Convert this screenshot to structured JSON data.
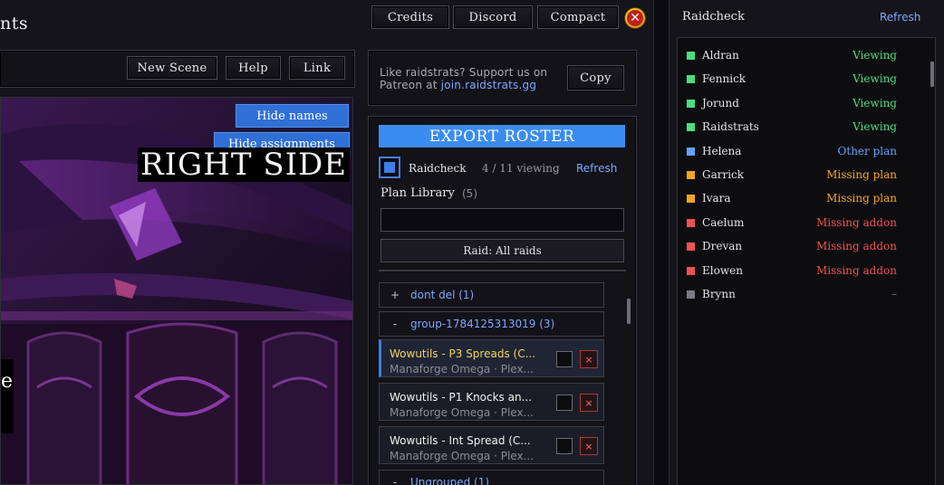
{
  "main": {
    "title_fragment": "nts",
    "top_buttons": {
      "credits": "Credits",
      "discord": "Discord",
      "compact": "Compact"
    },
    "toolbar": {
      "new_scene": "New Scene",
      "help": "Help",
      "link": "Link"
    },
    "scene": {
      "heading": "RIGHT SIDE",
      "hide_names": "Hide names",
      "hide_assignments": "Hide assignments",
      "label_fragment": "e"
    },
    "support": {
      "text": "Like raidstrats? Support us on Patreon at",
      "link": "join.raidstrats.gg",
      "copy": "Copy"
    },
    "export_roster": "EXPORT ROSTER",
    "raidcheck": {
      "label": "Raidcheck",
      "viewing": "4 / 11 viewing",
      "refresh": "Refresh"
    },
    "plan_library": {
      "title": "Plan Library",
      "count": "(5)",
      "search_value": "",
      "raid_filter": "Raid: All raids",
      "groups": [
        {
          "toggle": "+",
          "label": "dont del (1)"
        },
        {
          "toggle": "-",
          "label": "group-1784125313019 (3)"
        },
        {
          "toggle": "-",
          "label": "Ungrouped (1)"
        }
      ],
      "plans": [
        {
          "title": "Wowutils - P3 Spreads (C...",
          "subtitle": "Manaforge Omega · Plex...",
          "delete": "×"
        },
        {
          "title": "Wowutils - P1 Knocks an...",
          "subtitle": "Manaforge Omega · Plex...",
          "delete": "×"
        },
        {
          "title": "Wowutils - Int Spread (C...",
          "subtitle": "Manaforge Omega · Plex...",
          "delete": "×"
        }
      ]
    }
  },
  "raidcheck_window": {
    "title": "Raidcheck",
    "refresh": "Refresh",
    "members": [
      {
        "name": "Aldran",
        "status": "Viewing",
        "color": "#4ade80"
      },
      {
        "name": "Fennick",
        "status": "Viewing",
        "color": "#4ade80"
      },
      {
        "name": "Jorund",
        "status": "Viewing",
        "color": "#4ade80"
      },
      {
        "name": "Raidstrats",
        "status": "Viewing",
        "color": "#4ade80"
      },
      {
        "name": "Helena",
        "status": "Other plan",
        "color": "#60a5fa"
      },
      {
        "name": "Garrick",
        "status": "Missing plan",
        "color": "#f5a524"
      },
      {
        "name": "Ivara",
        "status": "Missing plan",
        "color": "#f5a524"
      },
      {
        "name": "Caelum",
        "status": "Missing addon",
        "color": "#f05252"
      },
      {
        "name": "Drevan",
        "status": "Missing addon",
        "color": "#f05252"
      },
      {
        "name": "Elowen",
        "status": "Missing addon",
        "color": "#f05252"
      },
      {
        "name": "Brynn",
        "status": "–",
        "color": "#7a7a84"
      }
    ]
  },
  "colors": {
    "accent": "#3b8cf0",
    "link": "#7ea7ff",
    "selected_title": "#f4d35e"
  }
}
